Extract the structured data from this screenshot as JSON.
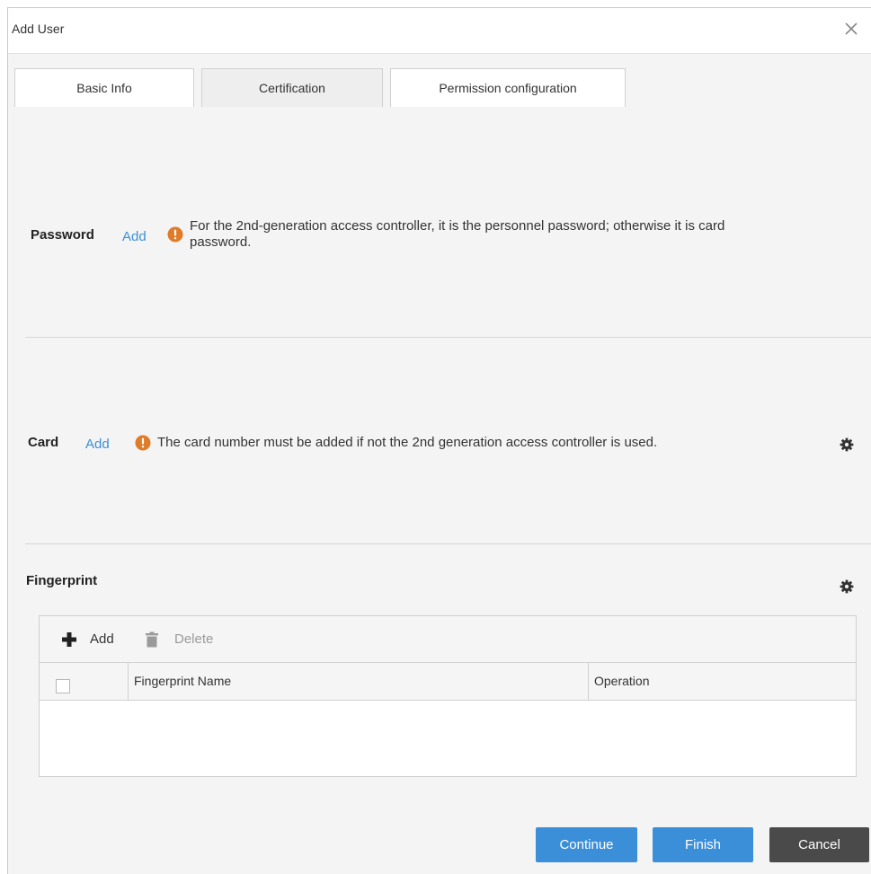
{
  "dialog": {
    "title": "Add User",
    "close_icon": "close-icon"
  },
  "tabs": [
    {
      "label": "Basic Info",
      "active": false
    },
    {
      "label": "Certification",
      "active": true
    },
    {
      "label": "Permission configuration",
      "active": false
    }
  ],
  "password": {
    "title": "Password",
    "add_label": "Add",
    "hint_line1": "For the 2nd-generation access controller, it is the personnel password; otherwise it is card",
    "hint_line2": "password.",
    "icon": "warning-icon"
  },
  "card": {
    "title": "Card",
    "add_label": "Add",
    "hint": "The card number must be added if not the 2nd generation access controller is used.",
    "icon": "warning-icon",
    "settings_icon": "gear-icon"
  },
  "fingerprint": {
    "title": "Fingerprint",
    "settings_icon": "gear-icon",
    "toolbar": {
      "add_label": "Add",
      "delete_label": "Delete"
    },
    "columns": [
      "Fingerprint Name",
      "Operation"
    ],
    "rows": []
  },
  "footer": {
    "continue_label": "Continue",
    "finish_label": "Finish",
    "cancel_label": "Cancel"
  },
  "colors": {
    "primary": "#3b8fd9",
    "cancel": "#4a4a4a",
    "warning": "#e07b2a",
    "background": "#f4f4f4"
  }
}
